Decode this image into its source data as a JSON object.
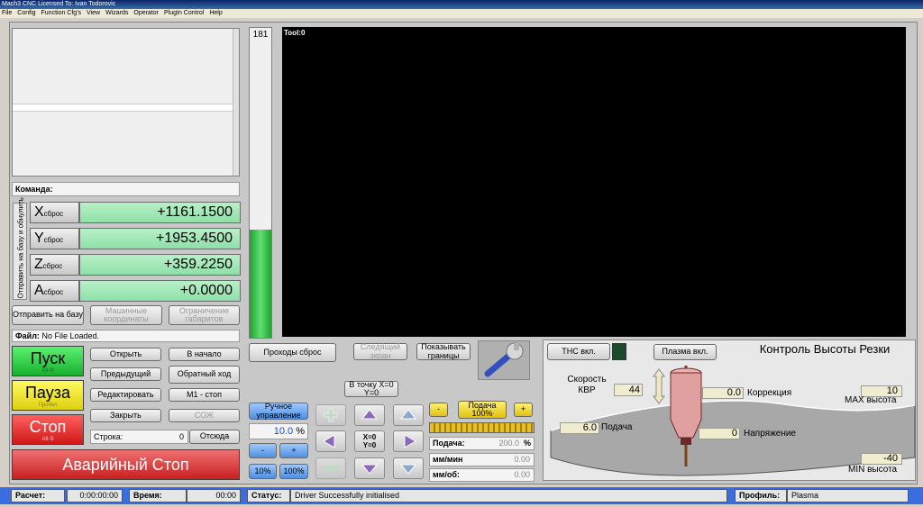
{
  "window": {
    "title": "Mach3 CNC  Licensed To: Ivan Todorovic"
  },
  "menu": [
    "File",
    "Config",
    "Function Cfg's",
    "View",
    "Wizards",
    "Operator",
    "PlugIn Control",
    "Help"
  ],
  "command": {
    "label": "Команда:"
  },
  "dro": {
    "vertical_label": "Отправить на базу и обнулить",
    "reset_small": "сброс",
    "axes": [
      {
        "name": "X",
        "value": "+1161.1500"
      },
      {
        "name": "Y",
        "value": "+1953.4500"
      },
      {
        "name": "Z",
        "value": "+359.2250"
      },
      {
        "name": "A",
        "value": "+0.0000"
      }
    ]
  },
  "buttons": {
    "home": "Отправить на базу",
    "machine_coords": "Машинные координаты",
    "soft_limits": "Ограничение габаритов",
    "open": "Открыть",
    "rewind": "В начало",
    "prev": "Предыдущий",
    "reverse": "Обратный ход",
    "edit": "Редактировать",
    "m1_stop": "M1 - стоп",
    "close": "Закрыть",
    "flood": "СОЖ",
    "from_here": "Отсюда",
    "start": "Пуск",
    "start_sub": "Alt-R",
    "pause": "Пауза",
    "pause_sub": "Пробел",
    "stop": "Стоп",
    "stop_sub": "Alt-S",
    "estop": "Аварийный Стоп",
    "reset_passes": "Проходы сброс",
    "follow_screen": "Следящий экран",
    "show_limits": "Показывать границы",
    "goto_zero": "В точку X=0 Y=0",
    "manual_control": "Ручное управление",
    "thc_on": "THC вкл.",
    "plasma_on": "Плазма вкл."
  },
  "file": {
    "label": "Файл:",
    "value": "No File Loaded."
  },
  "line": {
    "label": "Строка:",
    "value": "0"
  },
  "bar": {
    "number": "181",
    "level": 0.35
  },
  "toolpath": {
    "label": "Tool:0"
  },
  "jog": {
    "percent": "10.0",
    "percent_unit": "%",
    "minus": "-",
    "plus": "+",
    "p10": "10%",
    "p100": "100%",
    "xyzero": "X=0 Y=0"
  },
  "feed": {
    "minus": "-",
    "plus": "+",
    "label_top": "Подача 100%",
    "feed_label": "Подача:",
    "feed_value": "200.0",
    "feed_unit": "%",
    "mm_min_label": "мм/мин",
    "mm_min_value": "0.00",
    "mm_rev_label": "мм/об:",
    "mm_rev_value": "0.00"
  },
  "thc": {
    "title": "Контроль Высоты Резки",
    "speed_label": "Скорость КВР",
    "speed_value": "44",
    "correction_value": "0.0",
    "correction_label": "Коррекция",
    "max_value": "10",
    "max_label": "MAX высота",
    "feed_value": "6.0",
    "feed_label": "Подача",
    "voltage_value": "0",
    "voltage_label": "Напряжение",
    "min_value": "-40",
    "min_label": "MIN высота"
  },
  "status": {
    "run_label": "Расчет:",
    "run_value": "0:00:00:00",
    "time_label": "Время:",
    "time_value": "00:00",
    "status_label": "Статус:",
    "status_value": "Driver Successfully initialised",
    "profile_label": "Профиль:",
    "profile_value": "Plasma"
  },
  "colors": {
    "accent": "#3a6ee0",
    "green": "#22c040",
    "red": "#e02020",
    "yellow": "#f0e020"
  }
}
